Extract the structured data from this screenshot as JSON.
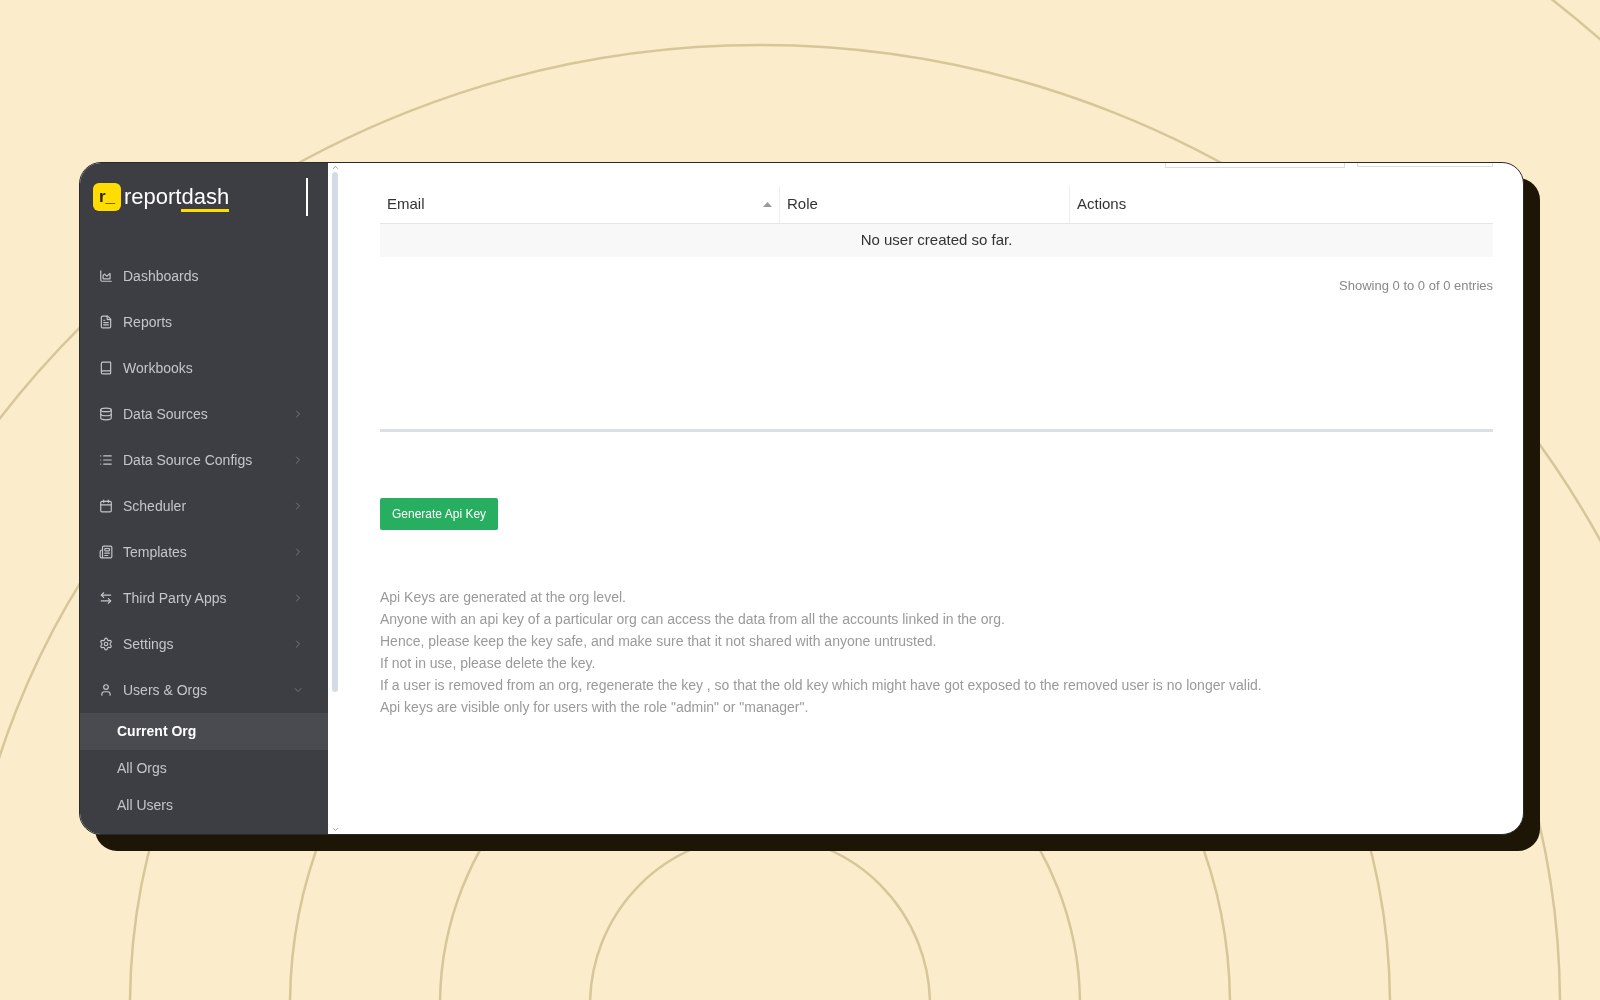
{
  "brand": {
    "mark": "r_",
    "text": "report",
    "accent": "dash"
  },
  "sidebar": {
    "items": [
      {
        "label": "Dashboards",
        "expandable": false
      },
      {
        "label": "Reports",
        "expandable": false
      },
      {
        "label": "Workbooks",
        "expandable": false
      },
      {
        "label": "Data Sources",
        "expandable": true,
        "expanded": false
      },
      {
        "label": "Data Source Configs",
        "expandable": true,
        "expanded": false
      },
      {
        "label": "Scheduler",
        "expandable": true,
        "expanded": false
      },
      {
        "label": "Templates",
        "expandable": true,
        "expanded": false
      },
      {
        "label": "Third Party Apps",
        "expandable": true,
        "expanded": false
      },
      {
        "label": "Settings",
        "expandable": true,
        "expanded": false
      },
      {
        "label": "Users & Orgs",
        "expandable": true,
        "expanded": true,
        "children": [
          {
            "label": "Current Org",
            "selected": true
          },
          {
            "label": "All Orgs",
            "selected": false
          },
          {
            "label": "All Users",
            "selected": false
          }
        ]
      }
    ]
  },
  "table": {
    "columns": [
      {
        "label": "Email",
        "sorted": true
      },
      {
        "label": "Role",
        "sorted": false
      },
      {
        "label": "Actions",
        "sorted": false
      }
    ],
    "empty_message": "No user created so far.",
    "info": "Showing 0 to 0 of 0 entries"
  },
  "generate_button": "Generate Api Key",
  "notes": [
    "Api Keys are generated at the org level.",
    "Anyone with an api key of a particular org can access the data from all the accounts linked in the org.",
    "Hence, please keep the key safe, and make sure that it not shared with anyone untrusted.",
    "If not in use, please delete the key.",
    "If a user is removed from an org, regenerate the key , so that the old key which might have got exposed to the removed user is no longer valid.",
    "Api keys are visible only for users with the role \"admin\" or \"manager\"."
  ]
}
